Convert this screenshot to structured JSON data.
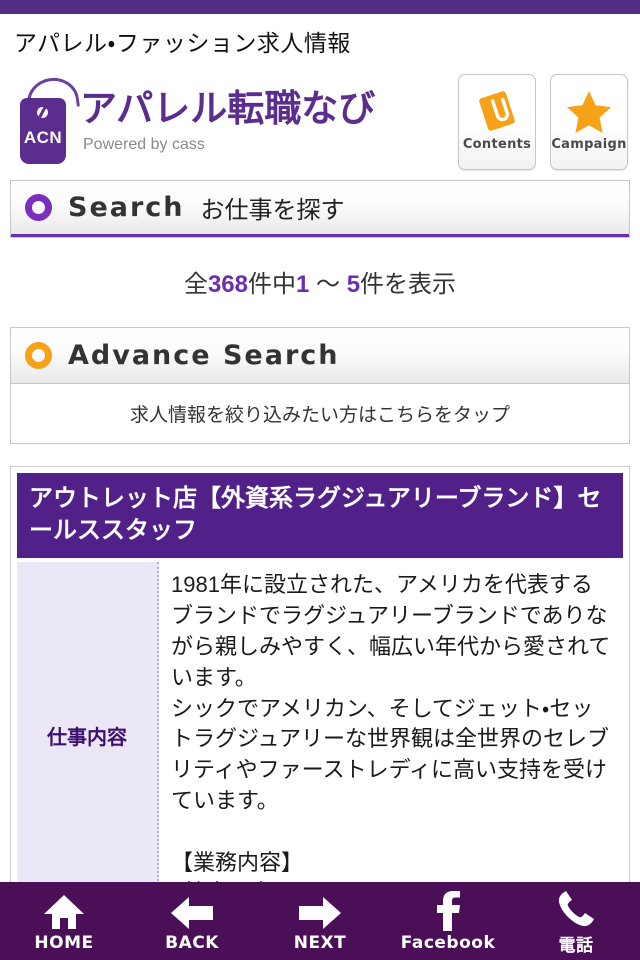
{
  "page": {
    "title": "アパレル・ファッション求人情報"
  },
  "brand": {
    "tag_text": "ACN",
    "name": "アパレル転職なび",
    "tagline": "Powered by cass"
  },
  "header_buttons": [
    {
      "label": "Contents",
      "icon": "document-clip-icon"
    },
    {
      "label": "Campaign",
      "icon": "star-icon"
    }
  ],
  "search_section": {
    "icon": "purple-ring-icon",
    "en_label": "Search",
    "ja_label": "お仕事を探す"
  },
  "result_count": {
    "prefix": "全",
    "total": "368",
    "middle": "件中",
    "from": "1",
    "range_sep": "〜",
    "to": "5",
    "suffix": "件を表示"
  },
  "advance_search": {
    "icon": "orange-ring-icon",
    "en_label": "Advance Search",
    "tap_text": "求人情報を絞り込みたい方はこちらをタップ"
  },
  "job": {
    "title": "アウトレット店【外資系ラグジュアリーブランド】セールススタッフ",
    "label": "仕事内容",
    "content": "1981年に設立された、アメリカを代表するブランドでラグジュアリーブランドでありながら親しみやすく、幅広い年代から愛されています。\nシックでアメリカン、そしてジェット・セットラグジュアリーな世界観は全世界のセレブリティやファーストレディに高い支持を受けています。\n\n【業務内容】\n■接客販売"
  },
  "bottom_nav": [
    {
      "label": "HOME",
      "icon": "home-icon"
    },
    {
      "label": "BACK",
      "icon": "arrow-left-icon"
    },
    {
      "label": "NEXT",
      "icon": "arrow-right-icon"
    },
    {
      "label": "Facebook",
      "icon": "facebook-icon"
    },
    {
      "label": "電話",
      "icon": "phone-icon"
    }
  ],
  "colors": {
    "top_strip": "#542d84",
    "brand_purple": "#5b2d8e",
    "card_purple": "#522089",
    "nav_purple": "#4a0f57",
    "accent_orange": "#f5a218",
    "label_bg": "#ece7f6"
  }
}
